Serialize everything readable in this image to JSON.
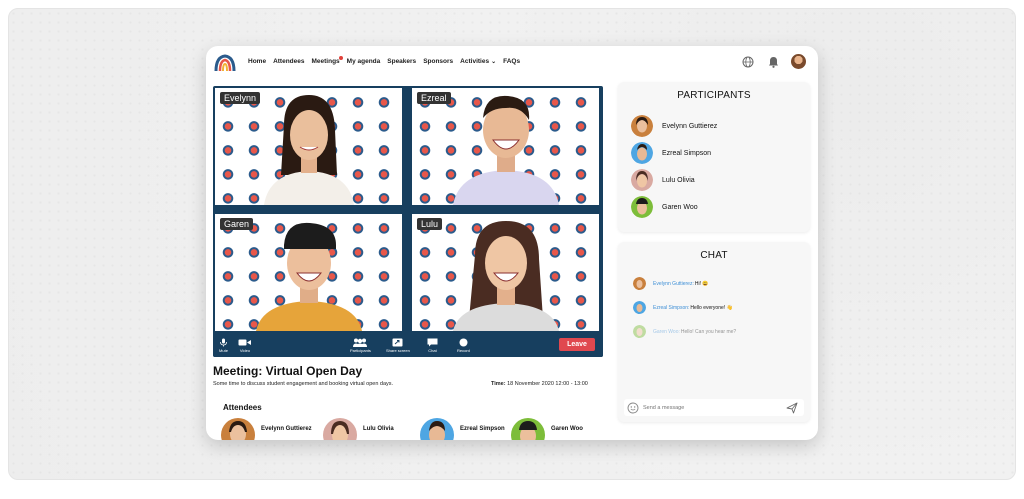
{
  "nav": {
    "items": [
      {
        "label": "Home"
      },
      {
        "label": "Attendees"
      },
      {
        "label": "Meetings",
        "has_dot": true
      },
      {
        "label": "My agenda"
      },
      {
        "label": "Speakers"
      },
      {
        "label": "Sponsors"
      },
      {
        "label": "Activities",
        "has_chevron": true
      },
      {
        "label": "FAQs"
      }
    ],
    "right_icons": [
      "globe-icon",
      "bell-icon",
      "user-avatar"
    ]
  },
  "video": {
    "tiles": [
      {
        "name": "Evelynn"
      },
      {
        "name": "Ezreal"
      },
      {
        "name": "Garen"
      },
      {
        "name": "Lulu"
      }
    ],
    "controls": {
      "mute_label": "Mute",
      "video_label": "Video",
      "participants_label": "Participants",
      "share_label": "Share screen",
      "chat_label": "Chat",
      "record_label": "Record",
      "leave_label": "Leave"
    }
  },
  "meeting": {
    "title": "Meeting: Virtual Open Day",
    "description": "Some time to discuss student engagement and booking virtual open days.",
    "time_label": "Time:",
    "time_value": "18 November 2020 12:00 - 13:00",
    "attendees_heading": "Attendees",
    "attendees": [
      {
        "name": "Evelynn Guttierez"
      },
      {
        "name": "Lulu Olivia"
      },
      {
        "name": "Ezreal Simpson"
      },
      {
        "name": "Garen Woo"
      }
    ]
  },
  "participants": {
    "title": "PARTICIPANTS",
    "list": [
      {
        "name": "Evelynn Guttierez"
      },
      {
        "name": "Ezreal Simpson"
      },
      {
        "name": "Lulu Olivia"
      },
      {
        "name": "Garen Woo"
      }
    ]
  },
  "chat": {
    "title": "CHAT",
    "messages": [
      {
        "author": "Evelynn Guttierez:",
        "text": "Hi! 😀"
      },
      {
        "author": "Ezreal Simpson:",
        "text": "Hello everyone! 👋"
      },
      {
        "author": "Garen Woo:",
        "text": "Hello! Can you hear me?"
      }
    ],
    "input_placeholder": "Send a message"
  },
  "colors": {
    "accent_blue": "#3e8fd6",
    "leave_red": "#e0484f",
    "video_bg": "#173f5f",
    "notification_dot": "#e0413a"
  }
}
